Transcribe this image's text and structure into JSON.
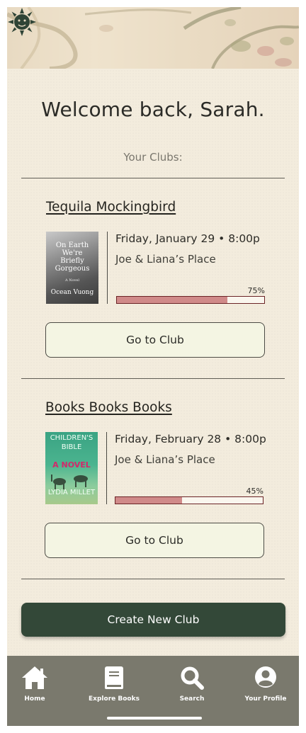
{
  "welcome": "Welcome back, Sarah.",
  "clubs_heading": "Your Clubs:",
  "clubs": [
    {
      "name": "Tequila Mockingbird",
      "date": "Friday, January 29 • 8:00p",
      "place": "Joe & Liana’s Place",
      "progress_label": "75%",
      "progress": 0.75,
      "cover_lines": [
        "On Earth",
        "We're",
        "Briefly",
        "Gorgeous"
      ],
      "cover_small": "A Novel",
      "cover_author": "Ocean Vuong",
      "button": "Go to Club"
    },
    {
      "name": "Books Books Books",
      "date": "Friday, February 28 • 8:00p",
      "place": "Joe & Liana’s Place",
      "progress_label": "45%",
      "progress": 0.45,
      "cover_lines": [
        "CHILDREN'S",
        "BIBLE"
      ],
      "cover_small": "A NOVEL",
      "cover_author": "LYDIA MILLET",
      "button": "Go to Club"
    }
  ],
  "create_button": "Create New Club",
  "tabs": [
    {
      "label": "Home",
      "icon": "home-icon"
    },
    {
      "label": "Explore Books",
      "icon": "book-icon"
    },
    {
      "label": "Search",
      "icon": "search-icon"
    },
    {
      "label": "Your Profile",
      "icon": "profile-icon"
    }
  ],
  "colors": {
    "background": "#f3ecdd",
    "primary_dark": "#334838",
    "button_light": "#f4f5e3",
    "progress_fill": "#d08a89",
    "tab_bar": "#7a796d"
  }
}
